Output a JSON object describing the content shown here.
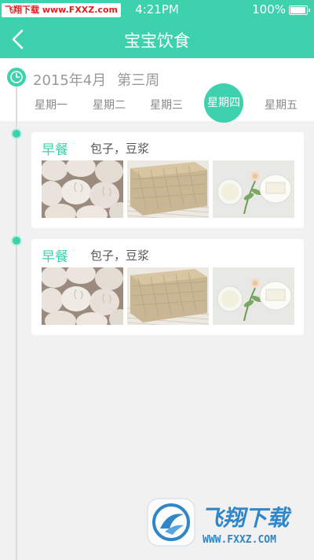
{
  "status_bar": {
    "watermark_part1": "飞翔下载",
    "watermark_part2": "www.FXXZ.com",
    "time": "4:21PM",
    "battery_percent": "100%",
    "battery_level": 1.0
  },
  "nav": {
    "title": "宝宝饮食"
  },
  "week": {
    "month": "2015年4月",
    "week_name": "第三周",
    "days": [
      "星期一",
      "星期二",
      "星期三",
      "星期四",
      "星期五"
    ],
    "selected_day": "星期四"
  },
  "meals": [
    {
      "type": "早餐",
      "items": "包子，豆浆",
      "photos": [
        "steamed-buns-photo",
        "bread-photo",
        "soy-milk-photo"
      ]
    },
    {
      "type": "早餐",
      "items": "包子，豆浆",
      "photos": [
        "steamed-buns-photo",
        "bread-photo",
        "soy-milk-photo"
      ]
    }
  ],
  "footer_logo": {
    "brand_text": "飞翔下载",
    "url_text": "WWW.FXXZ.COM"
  },
  "colors": {
    "accent": "#3dd1ad",
    "background": "#f1f1f1",
    "card": "#ffffff"
  }
}
